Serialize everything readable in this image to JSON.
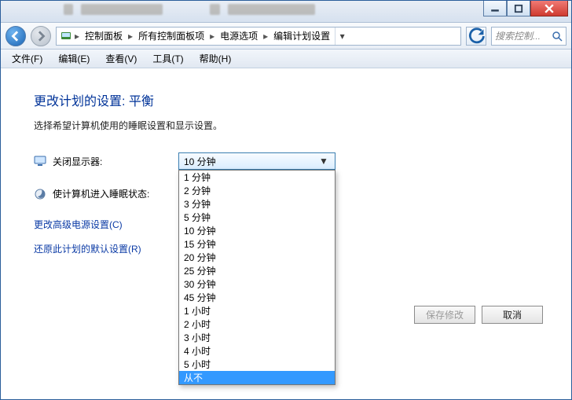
{
  "titlebar": {
    "minimize": "–",
    "maximize": "☐",
    "close": "×"
  },
  "breadcrumbs": {
    "items": [
      "控制面板",
      "所有控制面板项",
      "电源选项",
      "编辑计划设置"
    ]
  },
  "search": {
    "placeholder": "搜索控制..."
  },
  "menu": {
    "file": "文件(F)",
    "edit": "编辑(E)",
    "view": "查看(V)",
    "tools": "工具(T)",
    "help": "帮助(H)"
  },
  "page": {
    "title": "更改计划的设置: 平衡",
    "subtitle": "选择希望计算机使用的睡眠设置和显示设置。",
    "display_off_label": "关闭显示器:",
    "display_off_value": "10 分钟",
    "sleep_label": "使计算机进入睡眠状态:"
  },
  "dropdown": {
    "options": [
      "1 分钟",
      "2 分钟",
      "3 分钟",
      "5 分钟",
      "10 分钟",
      "15 分钟",
      "20 分钟",
      "25 分钟",
      "30 分钟",
      "45 分钟",
      "1 小时",
      "2 小时",
      "3 小时",
      "4 小时",
      "5 小时",
      "从不"
    ],
    "highlighted": "从不"
  },
  "links": {
    "advanced": "更改高级电源设置(C)",
    "restore": "还原此计划的默认设置(R)"
  },
  "buttons": {
    "save": "保存修改",
    "cancel": "取消"
  }
}
